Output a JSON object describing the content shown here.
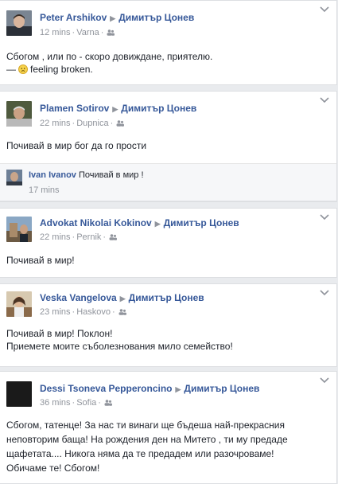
{
  "target_page": "Димитър Цонев",
  "colors": {
    "link": "#365899",
    "meta": "#90949c",
    "text": "#1d2129",
    "background": "#e9ebee"
  },
  "icons": {
    "audience": "friends-audience-icon",
    "separator": "right-arrow-icon",
    "menu": "chevron-down-icon",
    "feeling": "sad-emoji-icon"
  },
  "posts": [
    {
      "author": "Peter Arshikov",
      "target": "Димитър Цонев",
      "time": "12 mins",
      "location": "Varna",
      "text_lines": [
        "Сбогом , или по - скоро довиждане, приятелю."
      ],
      "feeling_prefix": "—",
      "feeling_text": "feeling broken."
    },
    {
      "author": "Plamen Sotirov",
      "target": "Димитър Цонев",
      "time": "22 mins",
      "location": "Dupnica",
      "text_lines": [
        "Почивай в мир бог да го прости"
      ],
      "comment": {
        "author": "Ivan Ivanov",
        "text": "Почивай в мир !",
        "time": "17 mins"
      }
    },
    {
      "author": "Advokat Nikolai Kokinov",
      "target": "Димитър Цонев",
      "time": "22 mins",
      "location": "Pernik",
      "text_lines": [
        "Почивай в мир!"
      ]
    },
    {
      "author": "Veska Vangelova",
      "target": "Димитър Цонев",
      "time": "23 mins",
      "location": "Haskovo",
      "text_lines": [
        "Почивай в мир! Поклон!",
        "Приемете моите съболезнования мило семейство!"
      ]
    },
    {
      "author": "Dessi Tsoneva Pepperoncino",
      "target": "Димитър Цонев",
      "time": "36 mins",
      "location": "Sofia",
      "text_lines": [
        "Сбогом, татенце! За нас ти винаги ще бъдеша най-прекрасния",
        "неповторим баща! На рождения ден на Митето , ти му предаде",
        "щафетата.... Никога няма да те предадем или разочроваме!",
        "Обичаме те! Сбогом!"
      ]
    }
  ]
}
